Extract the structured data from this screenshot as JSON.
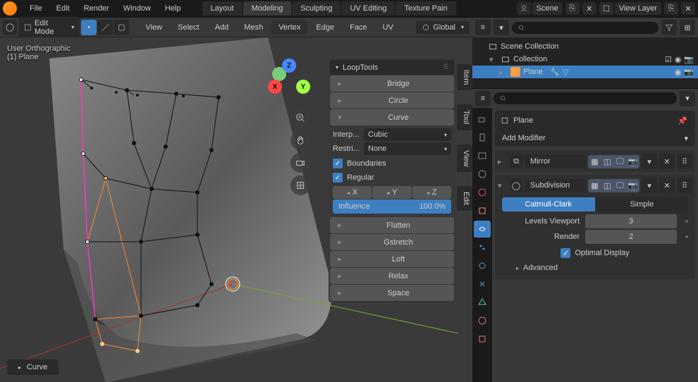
{
  "topmenu": {
    "file": "File",
    "edit": "Edit",
    "render": "Render",
    "window": "Window",
    "help": "Help"
  },
  "workspaces": {
    "layout": "Layout",
    "modeling": "Modeling",
    "sculpting": "Sculpting",
    "uv": "UV Editing",
    "texture": "Texture Pain"
  },
  "scene": {
    "label": "Scene",
    "viewlayer": "View Layer"
  },
  "toolbar": {
    "mode": "Edit Mode",
    "view": "View",
    "select": "Select",
    "add": "Add",
    "mesh": "Mesh",
    "vertex": "Vertex",
    "edge": "Edge",
    "face": "Face",
    "uv": "UV",
    "orientation": "Global"
  },
  "viewport": {
    "info1": "User Orthographic",
    "info2": "(1) Plane",
    "curve_btn": "Curve"
  },
  "axis": {
    "x": "X",
    "y": "Y",
    "z": "Z"
  },
  "sidetabs": {
    "item": "Item",
    "tool": "Tool",
    "view": "View",
    "edit": "Edit"
  },
  "looptools": {
    "title": "LoopTools",
    "bridge": "Bridge",
    "circle": "Circle",
    "curve": "Curve",
    "interp_lbl": "Interp...",
    "interp_val": "Cubic",
    "restrict_lbl": "Restri...",
    "restrict_val": "None",
    "boundaries": "Boundaries",
    "regular": "Regular",
    "x": "X",
    "y": "Y",
    "z": "Z",
    "influence_lbl": "Influence",
    "influence_val": "100.0%",
    "flatten": "Flatten",
    "gstretch": "Gstretch",
    "loft": "Loft",
    "relax": "Relax",
    "space": "Space"
  },
  "outliner": {
    "scene_collection": "Scene Collection",
    "collection": "Collection",
    "plane": "Plane"
  },
  "props": {
    "object_name": "Plane",
    "add_modifier": "Add Modifier",
    "mirror": "Mirror",
    "subdivision": "Subdivision",
    "catmull": "Catmull-Clark",
    "simple": "Simple",
    "levels_viewport_lbl": "Levels Viewport",
    "levels_viewport_val": "3",
    "render_lbl": "Render",
    "render_val": "2",
    "optimal_display": "Optimal Display",
    "advanced": "Advanced"
  }
}
